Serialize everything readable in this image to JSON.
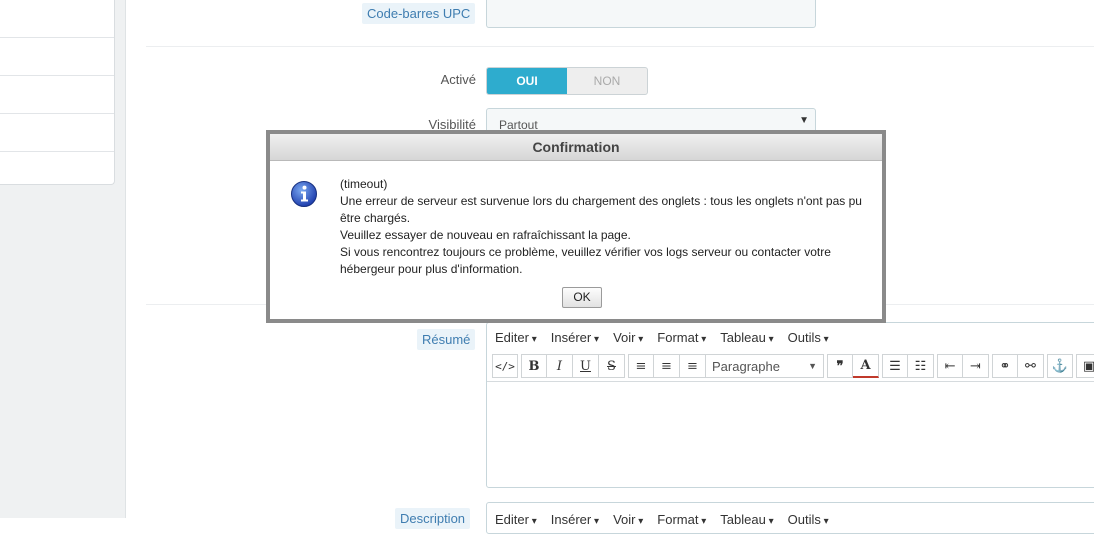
{
  "form": {
    "upc_label": "Code-barres UPC",
    "active_label": "Activé",
    "switch_on": "OUI",
    "switch_off": "NON",
    "visibility_label": "Visibilité",
    "visibility_value": "Partout",
    "summary_label": "Résumé",
    "description_label": "Description"
  },
  "editor": {
    "menus": [
      "Editer",
      "Insérer",
      "Voir",
      "Format",
      "Tableau",
      "Outils"
    ],
    "paragraph": "Paragraphe"
  },
  "dialog": {
    "title": "Confirmation",
    "lines": [
      "(timeout)",
      "Une erreur de serveur est survenue lors du chargement des onglets : tous les onglets n'ont pas pu être chargés.",
      "Veuillez essayer de nouveau en rafraîchissant la page.",
      "Si vous rencontrez toujours ce problème, veuillez vérifier vos logs serveur ou contacter votre hébergeur pour plus d'information."
    ],
    "ok": "OK"
  },
  "colors": {
    "accent": "#2eacce",
    "label_tag_bg": "#eaf3f9",
    "label_tag_text": "#3f7db0"
  }
}
